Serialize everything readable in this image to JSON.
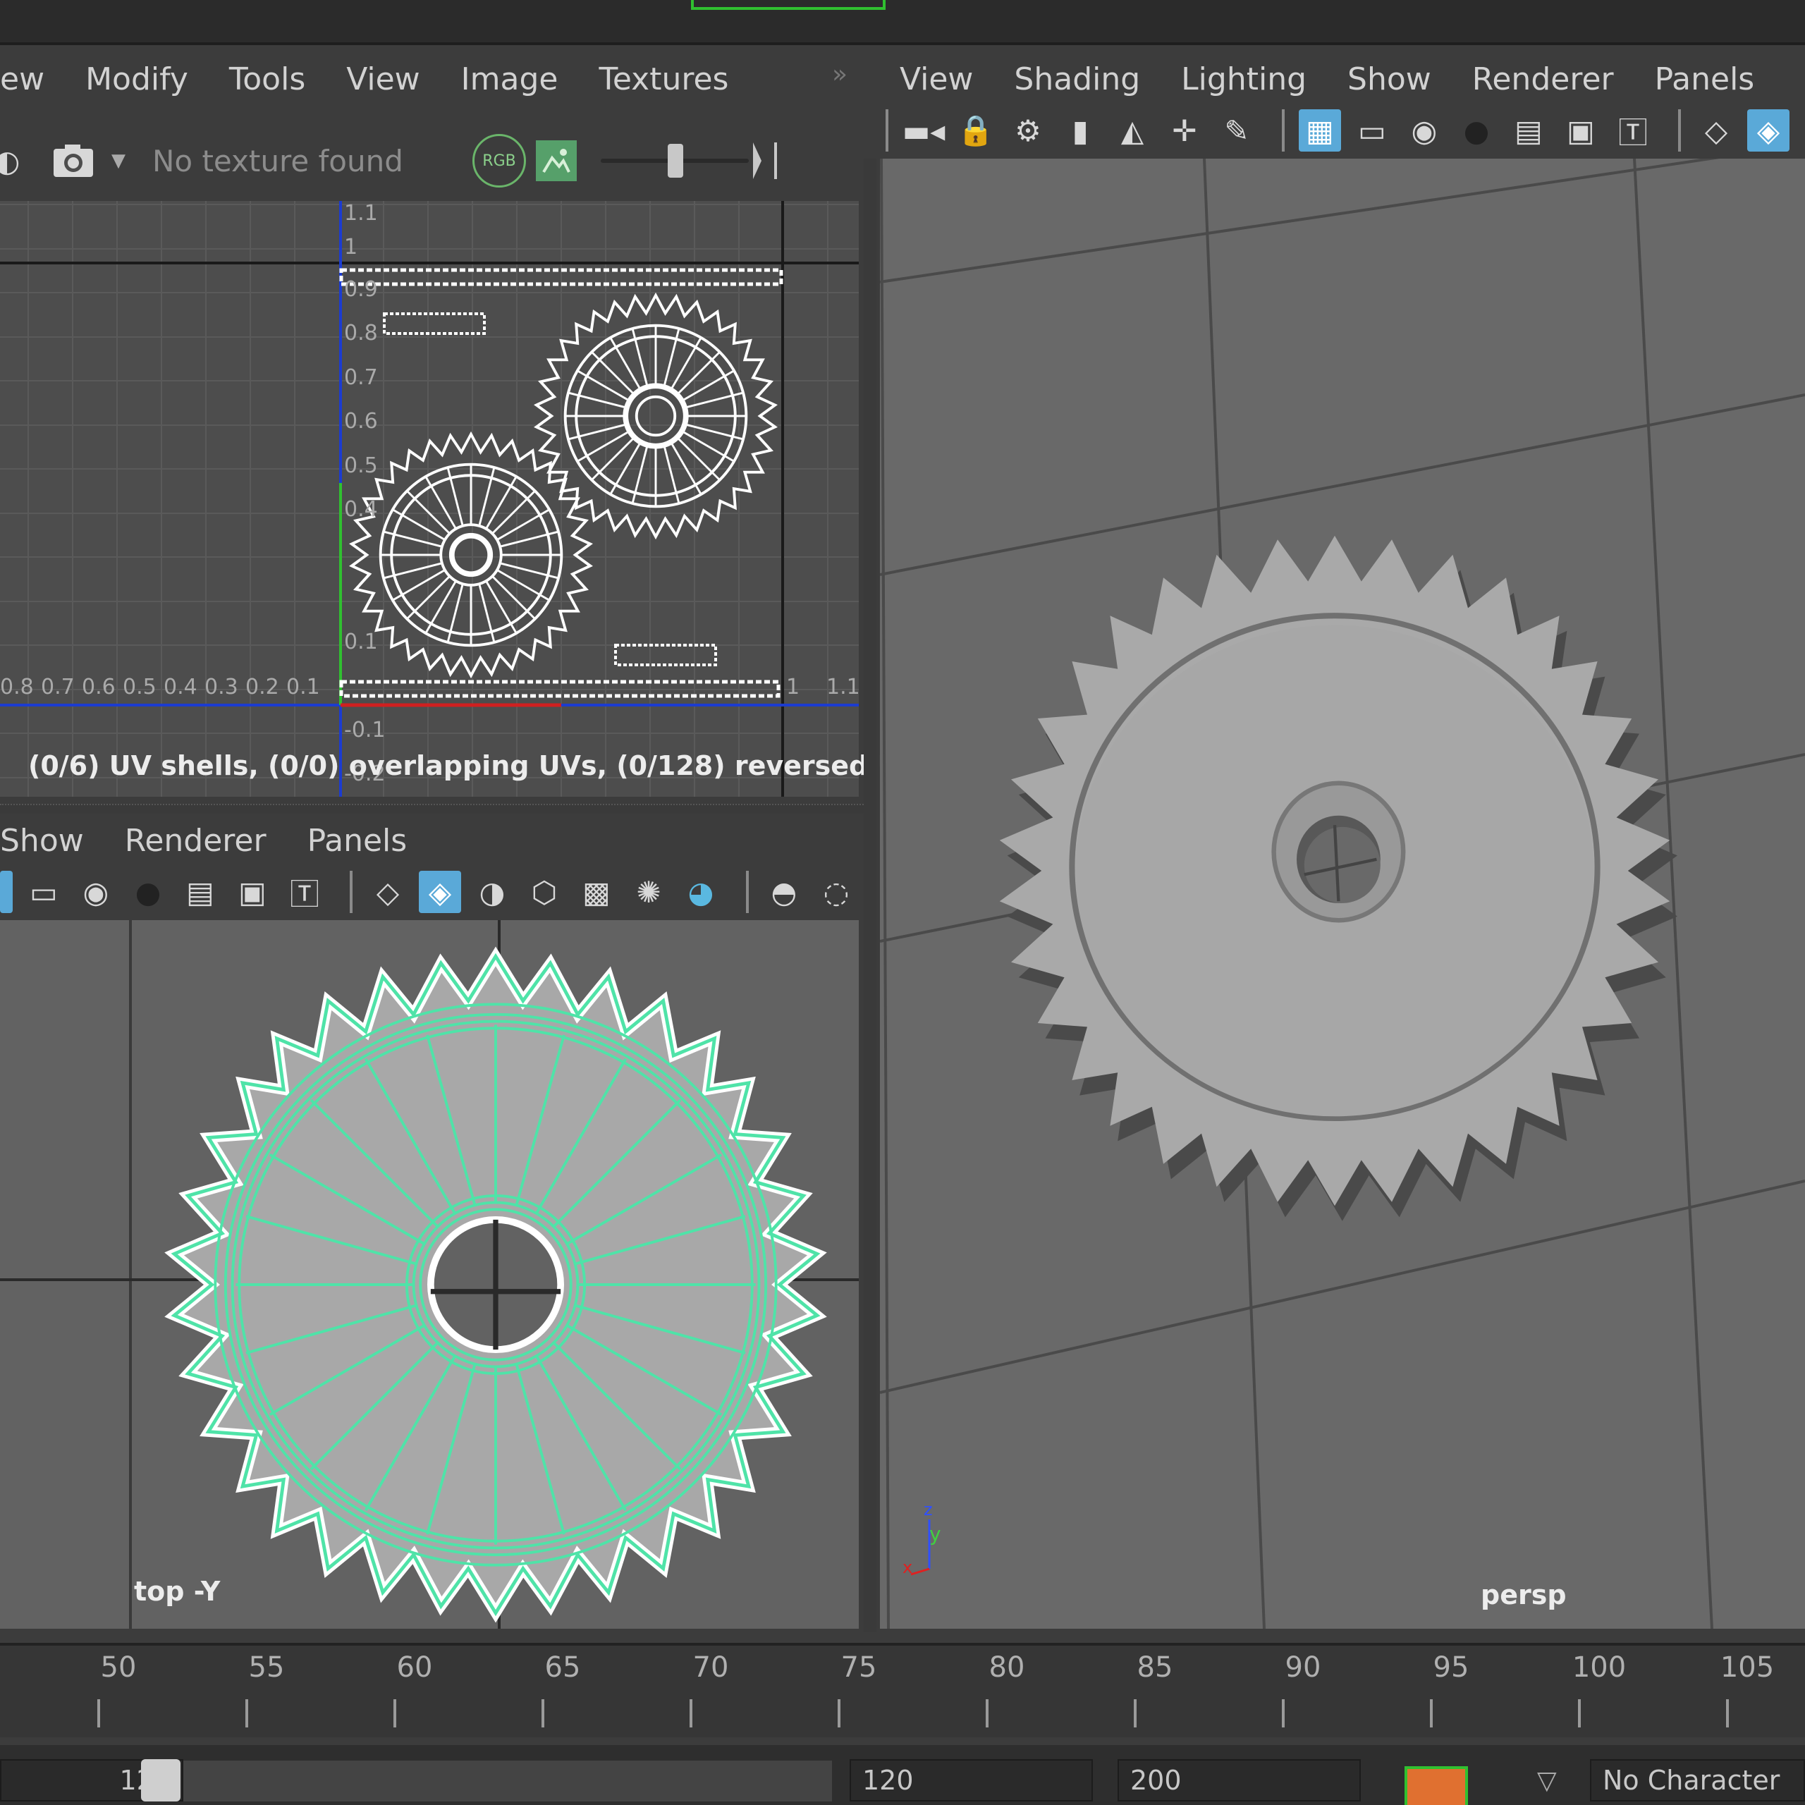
{
  "uv_editor": {
    "menu": [
      "ew",
      "Modify",
      "Tools",
      "View",
      "Image",
      "Textures"
    ],
    "texture_placeholder": "No texture found",
    "rgb_label": "RGB",
    "status": "(0/6) UV shells, (0/0) overlapping UVs, (0/128) reversed UVs",
    "axis_x_labels": [
      "0.8",
      "0.7",
      "0.6",
      "0.5",
      "0.4",
      "0.3",
      "0.2",
      "0.1"
    ],
    "axis_y_labels": [
      "1.1",
      "1",
      "0.9",
      "0.8",
      "0.7",
      "0.6",
      "0.5",
      "0.4",
      "0.1",
      "-0.1",
      "-0.2"
    ],
    "axis_x_right_labels": [
      "1",
      "1.1"
    ]
  },
  "persp_panel": {
    "menu": [
      "View",
      "Shading",
      "Lighting",
      "Show",
      "Renderer",
      "Panels"
    ],
    "camera_label": "persp"
  },
  "top_panel": {
    "menu": [
      "Show",
      "Renderer",
      "Panels"
    ],
    "camera_label": "top -Y"
  },
  "timeline": {
    "ticks": [
      "50",
      "55",
      "60",
      "65",
      "70",
      "75",
      "80",
      "85",
      "90",
      "95",
      "100",
      "105"
    ]
  },
  "range_bar": {
    "start_value": "120",
    "end_field": "120",
    "max_field": "200",
    "character_set": "No Character"
  },
  "icons": {
    "camera": "camera-icon",
    "grid": "grid-icon",
    "shaded": "shaded-cube-icon",
    "wireframe": "wireframe-cube-icon",
    "light": "light-bulb-icon"
  }
}
